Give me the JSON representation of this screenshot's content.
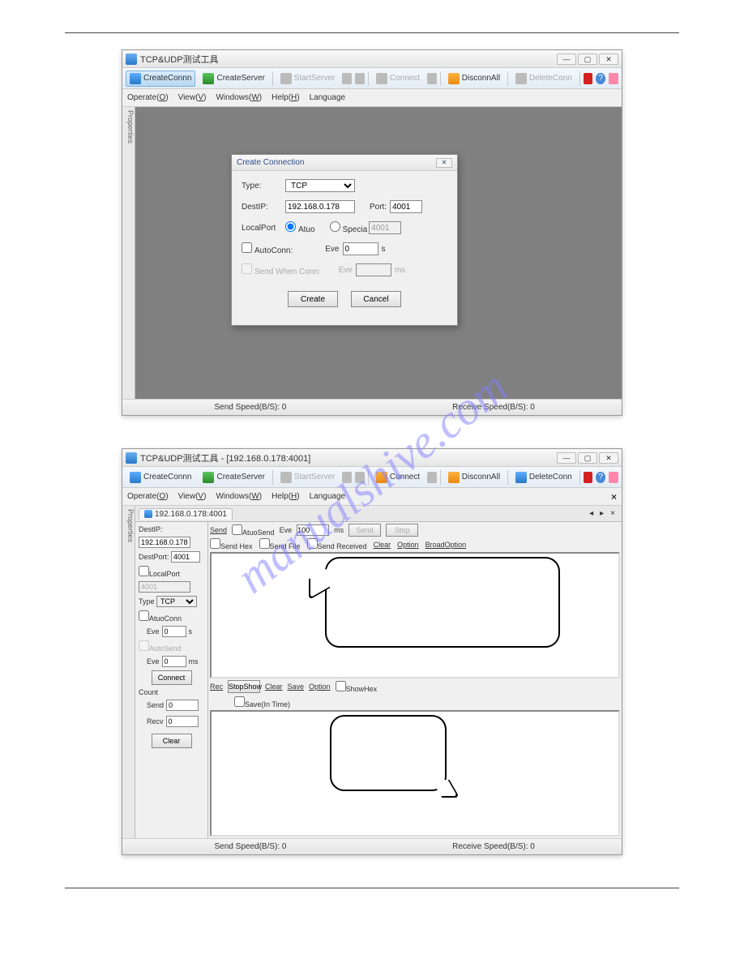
{
  "watermark": "manualshive.com",
  "win1": {
    "title": "TCP&UDP测试工具",
    "toolbar": {
      "createConn": "CreateConnn",
      "createServer": "CreateServer",
      "startServer": "StartServer",
      "connect": "Connect",
      "disconnAll": "DisconnAll",
      "deleteConn": "DeleteConn"
    },
    "menu": {
      "operate": "Operate(O)",
      "view": "View(V)",
      "windows": "Windows(W)",
      "help": "Help(H)",
      "language": "Language"
    },
    "vtab": "Properties",
    "status": {
      "send": "Send Speed(B/S): 0",
      "recv": "Receive Speed(B/S): 0"
    },
    "dialog": {
      "title": "Create Connection",
      "type": "Type:",
      "typeVal": "TCP",
      "destip": "DestIP:",
      "destipVal": "192.168.0.178",
      "port": "Port:",
      "portVal": "4001",
      "localport": "LocalPort",
      "atuo": "Atuo",
      "specia": "Specia",
      "speciaVal": "4001",
      "autoconn": "AutoConn:",
      "eve": "Eve",
      "eveVal1": "0",
      "s": "s",
      "sendwhen": "Send When Conn:",
      "ms": "ms",
      "create": "Create",
      "cancel": "Cancel"
    }
  },
  "win2": {
    "title": "TCP&UDP测试工具 - [192.168.0.178:4001]",
    "tab": "192.168.0.178:4001",
    "side": {
      "destip": "DestIP:",
      "destipVal": "192.168.0.178",
      "destport": "DestPort:",
      "destportVal": "4001",
      "localport": "LocalPort",
      "localportVal": "4001",
      "type": "Type",
      "typeVal": "TCP",
      "atuoconn": "AtuoConn",
      "eve": "Eve",
      "eve1": "0",
      "s": "s",
      "autosend": "AutoSend",
      "eve2": "0",
      "ms": "ms",
      "connect": "Connect",
      "count": "Count",
      "send": "Send",
      "sendVal": "0",
      "recv": "Recv",
      "recvVal": "0",
      "clear": "Clear"
    },
    "sendbar": {
      "send": "Send",
      "atuosend": "AtuoSend",
      "eve": "Eve",
      "eveVal": "100",
      "ms": "ms",
      "sendBtn": "Send",
      "stop": "Stop",
      "sendhex": "Send Hex",
      "sendfile": "Send File",
      "sendrecv": "Send Received",
      "clear": "Clear",
      "option": "Option",
      "broad": "BroadOption"
    },
    "recbar": {
      "rec": "Rec",
      "stopshow": "StopShow",
      "clear": "Clear",
      "save": "Save",
      "option": "Option",
      "showhex": "ShowHex",
      "saveintime": "Save(In Time)"
    }
  }
}
